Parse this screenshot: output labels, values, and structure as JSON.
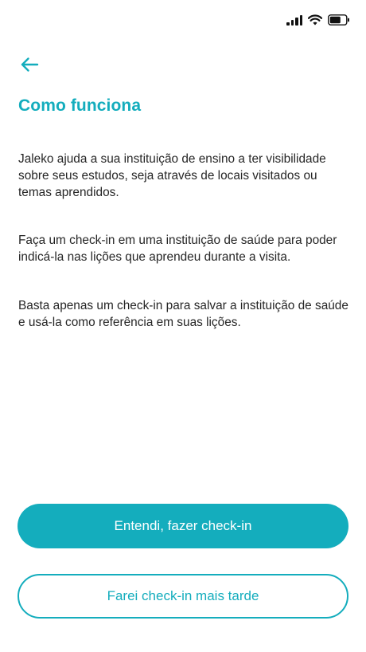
{
  "status_bar": {
    "icons": [
      "signal-icon",
      "wifi-icon",
      "battery-icon"
    ]
  },
  "header": {
    "back_icon": "arrow-left-icon",
    "title": "Como funciona"
  },
  "content": {
    "paragraphs": [
      "Jaleko ajuda a sua instituição de ensino a ter visibilidade sobre seus estudos, seja através de locais visitados ou temas aprendidos.",
      "Faça um check-in em uma instituição de saúde para poder indicá-la nas lições que aprendeu durante a visita.",
      "Basta apenas um check-in para salvar a instituição de saúde e usá-la como referência em suas lições."
    ]
  },
  "actions": {
    "primary_label": "Entendi, fazer check-in",
    "secondary_label": "Farei check-in mais tarde"
  },
  "colors": {
    "accent": "#14adbd",
    "text": "#262626",
    "background": "#ffffff"
  }
}
